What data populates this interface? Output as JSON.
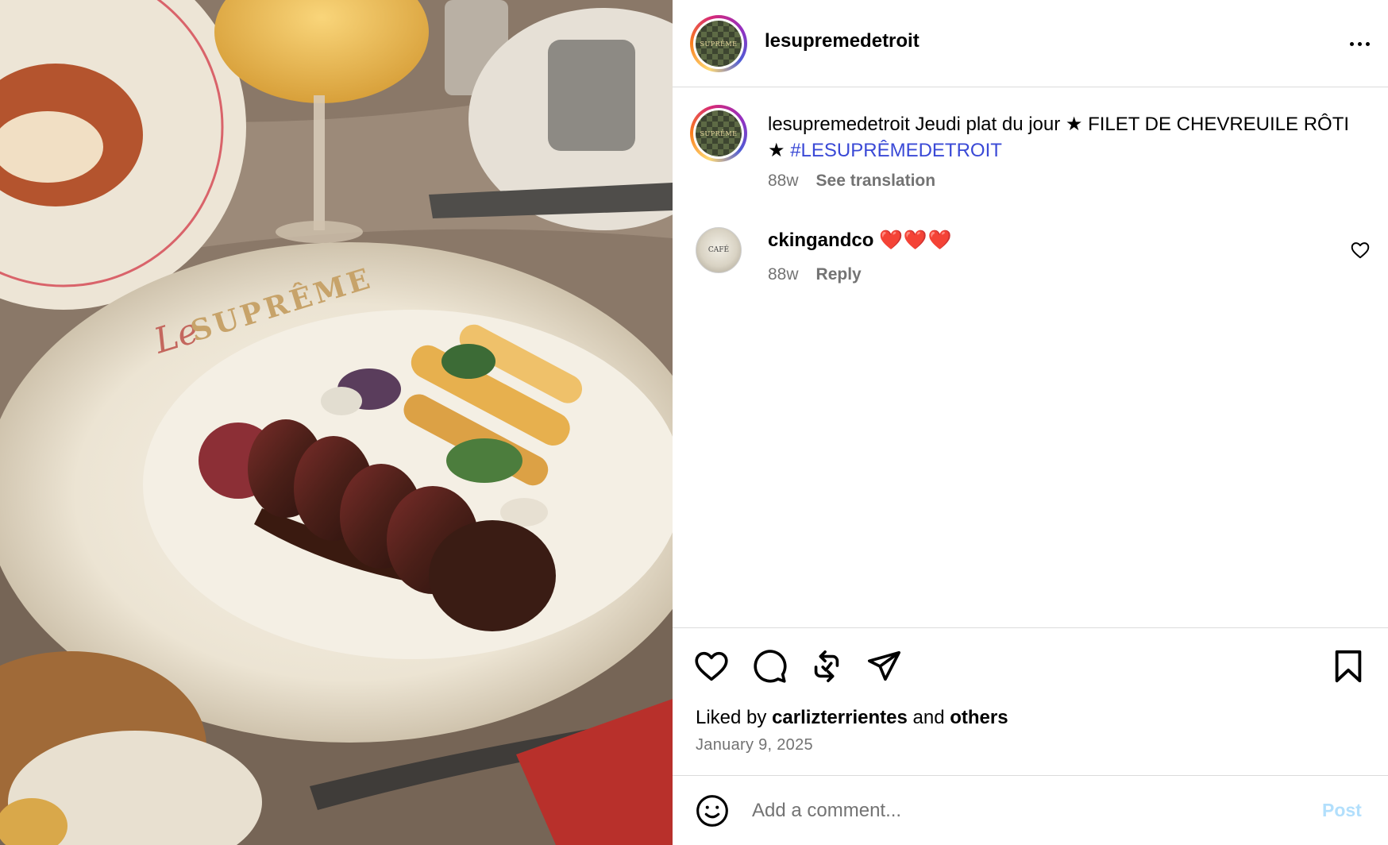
{
  "post": {
    "account_name": "lesupremedetroit",
    "avatar_text": "SUPRÊME",
    "plate_text": "SUPRÊME",
    "plate_script": "Le"
  },
  "caption": {
    "username": "lesupremedetroit",
    "text_line": "Jeudi plat du jour ★ FILET DE CHEVREUILE RÔTI ★",
    "hashtag": "#LESUPRÊMEDETROIT",
    "age": "88w",
    "see_translation": "See translation"
  },
  "comments": [
    {
      "username": "ckingandco",
      "text": "❤️❤️❤️",
      "age": "88w",
      "reply_label": "Reply",
      "avatar_text": "CAFÉ"
    }
  ],
  "likes": {
    "prefix": "Liked by",
    "user": "carlizterrientes",
    "connector": "and",
    "others": "others"
  },
  "date": "January 9, 2025",
  "composer": {
    "placeholder": "Add a comment...",
    "post_label": "Post"
  },
  "icons": {
    "more": "more-horizontal-icon",
    "like": "heart-icon",
    "comment": "comment-bubble-icon",
    "repost": "repost-icon",
    "share": "send-icon",
    "save": "bookmark-icon",
    "emoji": "emoji-icon"
  },
  "colors": {
    "hashtag": "#3a49d6",
    "secondary_text": "#737373",
    "post_button_disabled": "#b2dffc",
    "divider": "#dbdbdb"
  }
}
